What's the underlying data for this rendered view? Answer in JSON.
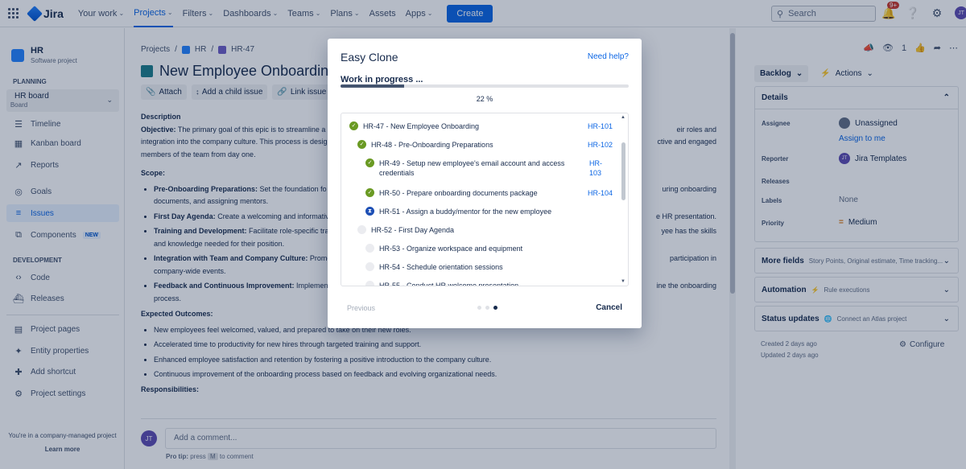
{
  "topnav": {
    "app": "Jira",
    "items": [
      {
        "label": "Your work",
        "caret": true
      },
      {
        "label": "Projects",
        "caret": true,
        "active": true
      },
      {
        "label": "Filters",
        "caret": true
      },
      {
        "label": "Dashboards",
        "caret": true
      },
      {
        "label": "Teams",
        "caret": true
      },
      {
        "label": "Plans",
        "caret": true
      },
      {
        "label": "Assets",
        "caret": false
      },
      {
        "label": "Apps",
        "caret": true
      }
    ],
    "create": "Create",
    "search_placeholder": "Search",
    "notif_count": "9+",
    "avatar": "JT"
  },
  "sidebar": {
    "project_name": "HR",
    "project_type": "Software project",
    "planning": "PLANNING",
    "board_name": "HR board",
    "board_sub": "Board",
    "items": [
      "Timeline",
      "Kanban board",
      "Reports",
      "Goals",
      "Issues",
      "Components",
      "Code",
      "Releases",
      "Project pages",
      "Entity properties",
      "Add shortcut",
      "Project settings"
    ],
    "new_badge": "NEW",
    "development": "DEVELOPMENT",
    "footer": "You're in a company-managed project",
    "learn_more": "Learn more"
  },
  "issue": {
    "crumb_projects": "Projects",
    "crumb_project": "HR",
    "crumb_key": "HR-47",
    "title": "New Employee Onboarding",
    "actions": [
      "Attach",
      "Add a child issue",
      "Link issue"
    ],
    "description_label": "Description",
    "objective_label": "Objective:",
    "objective_text": " The primary goal of this epic is to streamline a",
    "objective_right": "eir roles and",
    "line2_left": "integration into the company culture. This process is desig",
    "line2_right": "ctive and engaged",
    "line3": "members of the team from day one.",
    "scope_label": "Scope:",
    "scope": [
      {
        "b": "Pre-Onboarding Preparations:",
        "t": " Set the foundation fo",
        "r": "uring onboarding",
        "l2": "documents, and assigning mentors."
      },
      {
        "b": "First Day Agenda:",
        "t": " Create a welcoming and informativ",
        "r": "e HR presentation.",
        "l2": ""
      },
      {
        "b": "Training and Development:",
        "t": " Facilitate role-specific tra",
        "r": "yee has the skills",
        "l2": "and knowledge needed for their position."
      },
      {
        "b": "Integration with Team and Company Culture:",
        "t": " Promo",
        "r": "participation in",
        "l2": "company-wide events."
      },
      {
        "b": "Feedback and Continuous Improvement:",
        "t": " Implement",
        "r": "ine the onboarding",
        "l2": "process."
      }
    ],
    "outcomes_label": "Expected Outcomes:",
    "outcomes": [
      "New employees feel welcomed, valued, and prepared to take on their new roles.",
      "Accelerated time to productivity for new hires through targeted training and support.",
      "Enhanced employee satisfaction and retention by fostering a positive introduction to the company culture.",
      "Continuous improvement of the onboarding process based on feedback and evolving organizational needs."
    ],
    "responsibilities_label": "Responsibilities:",
    "comment_avatar": "JT",
    "comment_placeholder": "Add a comment...",
    "protip_a": "Pro tip:",
    "protip_b": " press ",
    "protip_key": "M",
    "protip_c": " to comment"
  },
  "right": {
    "watch_count": "1",
    "backlog": "Backlog",
    "actions": "Actions",
    "details": "Details",
    "assignee_label": "Assignee",
    "assignee": "Unassigned",
    "assign_me": "Assign to me",
    "reporter_label": "Reporter",
    "reporter": "Jira Templates",
    "reporter_avatar": "JT",
    "releases_label": "Releases",
    "labels_label": "Labels",
    "labels": "None",
    "priority_label": "Priority",
    "priority": "Medium",
    "more_fields": "More fields",
    "more_fields_sub": "Story Points, Original estimate, Time tracking...",
    "automation": "Automation",
    "automation_sub": "Rule executions",
    "status_updates": "Status updates",
    "status_sub": "Connect an Atlas project",
    "created": "Created 2 days ago",
    "updated": "Updated 2 days ago",
    "configure": "Configure"
  },
  "modal": {
    "title": "Easy Clone",
    "help": "Need help?",
    "wip": "Work in progress ...",
    "progress": 0.22,
    "pct": "22 %",
    "items": [
      {
        "text": "HR-47 - New Employee Onboarding",
        "key": "HR-101",
        "status": "done",
        "level": 0
      },
      {
        "text": "HR-48 - Pre-Onboarding Preparations",
        "key": "HR-102",
        "status": "done",
        "level": 1
      },
      {
        "text": "HR-49 - Setup new employee's email account and access credentials",
        "key": "HR-103",
        "status": "done",
        "level": 2
      },
      {
        "text": "HR-50 - Prepare onboarding documents package",
        "key": "HR-104",
        "status": "done",
        "level": 2
      },
      {
        "text": "HR-51 - Assign a buddy/mentor for the new employee",
        "key": "",
        "status": "progress",
        "level": 2
      },
      {
        "text": "HR-52 - First Day Agenda",
        "key": "",
        "status": "pending",
        "level": 1
      },
      {
        "text": "HR-53 - Organize workspace and equipment",
        "key": "",
        "status": "pending",
        "level": 2
      },
      {
        "text": "HR-54 - Schedule orientation sessions",
        "key": "",
        "status": "pending",
        "level": 2
      },
      {
        "text": "HR-55 - Conduct HR welcome presentation",
        "key": "",
        "status": "pending",
        "level": 2
      }
    ],
    "previous": "Previous",
    "cancel": "Cancel"
  }
}
